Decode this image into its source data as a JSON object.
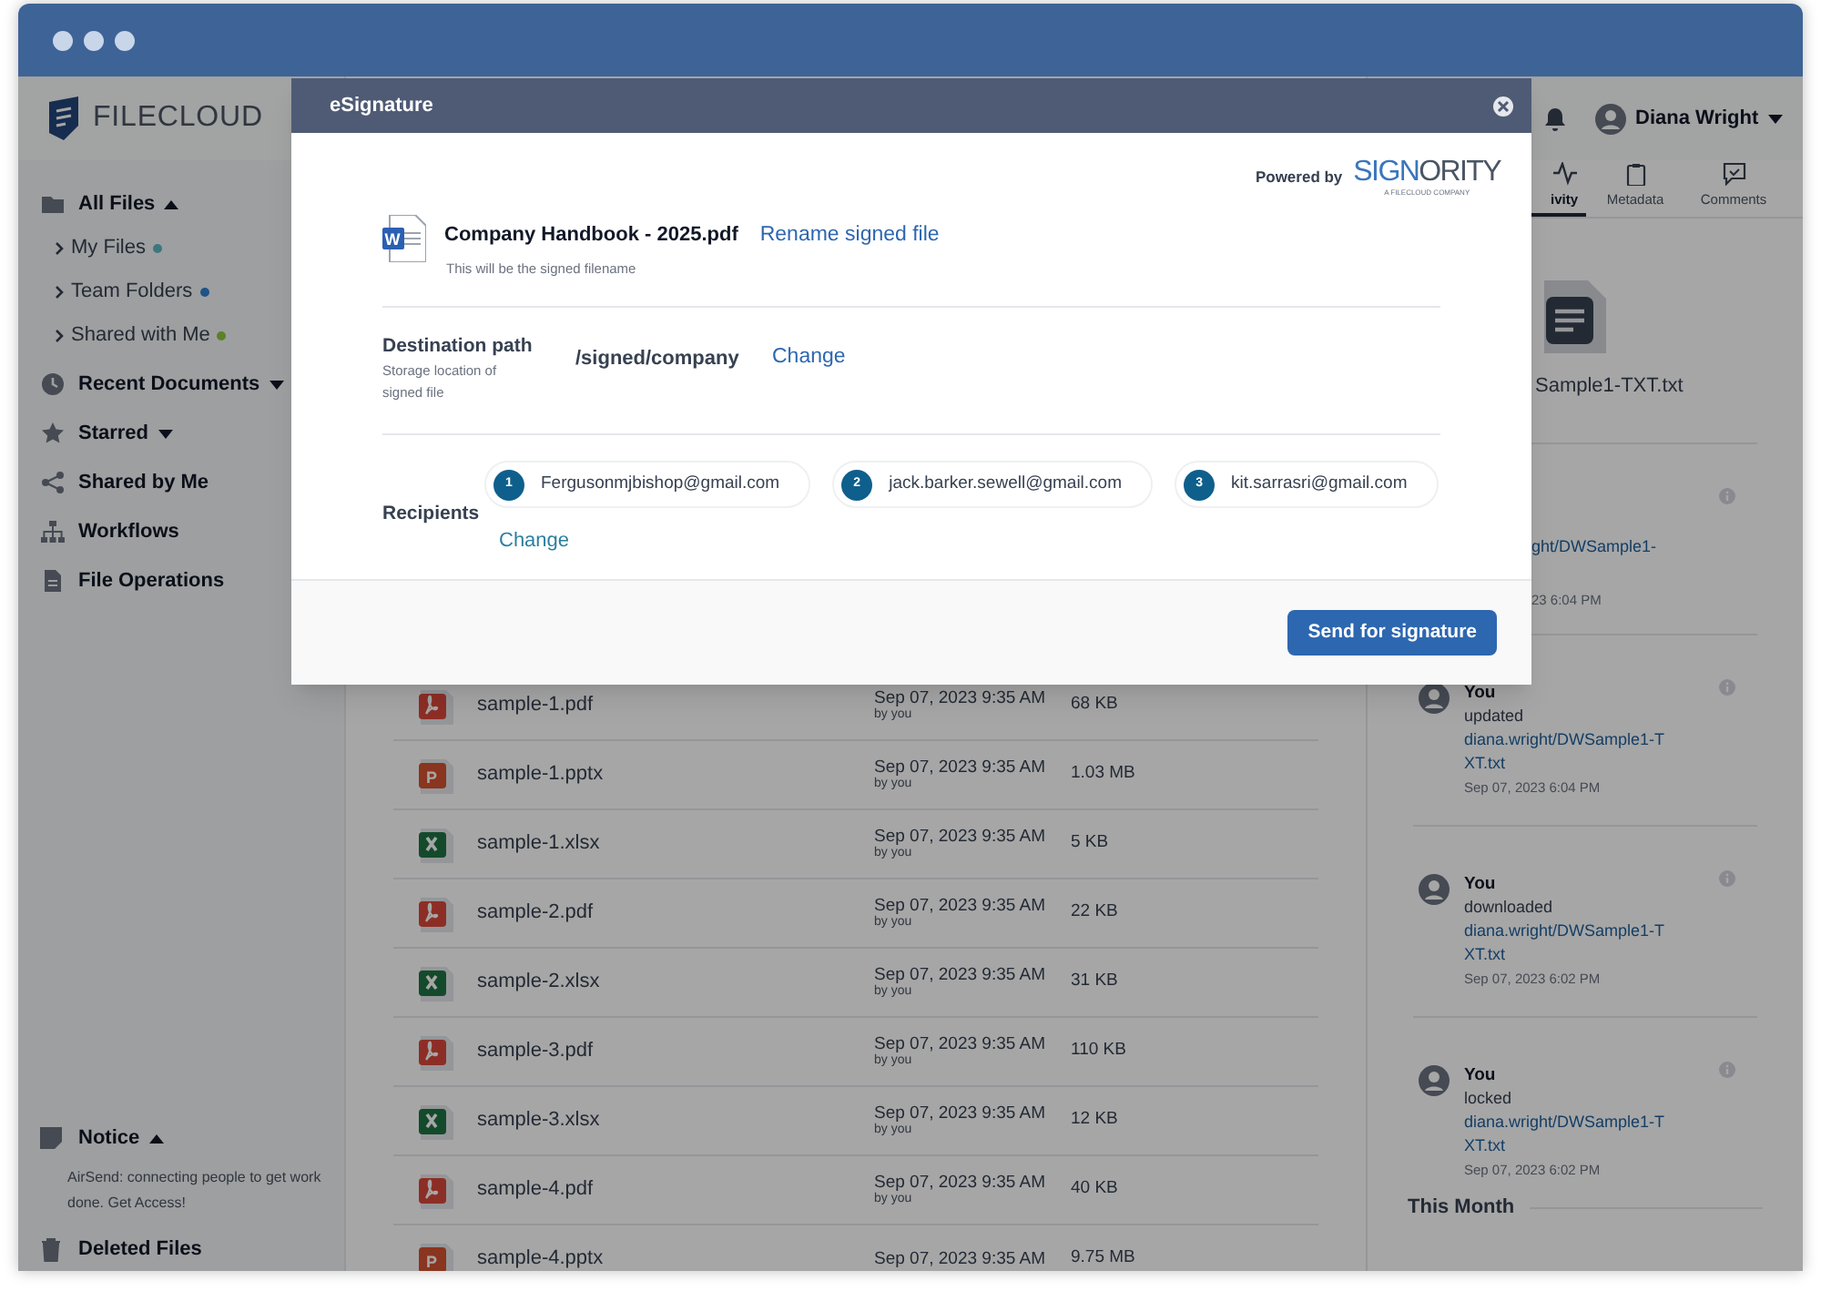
{
  "app": {
    "logo_text": "FILECLOUD"
  },
  "sidebar": {
    "items": [
      {
        "kind": "folder",
        "label": "All Files",
        "expanded": true,
        "children": [
          {
            "label": "My Files",
            "color": "#3e767e"
          },
          {
            "label": "Team Folders",
            "color": "#1f5387"
          },
          {
            "label": "Shared with Me",
            "color": "#5b8129"
          }
        ]
      },
      {
        "kind": "clock",
        "label": "Recent Documents",
        "expanded": false
      },
      {
        "kind": "star",
        "label": "Starred",
        "expanded": false
      },
      {
        "kind": "share",
        "label": "Shared by Me"
      },
      {
        "kind": "workflow",
        "label": "Workflows"
      },
      {
        "kind": "doc",
        "label": "File Operations"
      }
    ],
    "notice": {
      "title": "Notice",
      "expanded": true,
      "text": "AirSend: connecting people to get work done. Get Access!"
    },
    "footer_item": {
      "label": "Deleted Files"
    }
  },
  "files": [
    {
      "kind": "pdf",
      "name": "sample-1.pdf",
      "modified": "Sep 07, 2023 9:35 AM",
      "by": "by you",
      "size": "68 KB"
    },
    {
      "kind": "pptx",
      "icon_letter": "P",
      "name": "sample-1.pptx",
      "modified": "Sep 07, 2023 9:35 AM",
      "by": "by you",
      "size": "1.03 MB"
    },
    {
      "kind": "xlsx",
      "name": "sample-1.xlsx",
      "modified": "Sep 07, 2023 9:35 AM",
      "by": "by you",
      "size": "5 KB"
    },
    {
      "kind": "pdf",
      "name": "sample-2.pdf",
      "modified": "Sep 07, 2023 9:35 AM",
      "by": "by you",
      "size": "22 KB"
    },
    {
      "kind": "xlsx",
      "name": "sample-2.xlsx",
      "modified": "Sep 07, 2023 9:35 AM",
      "by": "by you",
      "size": "31 KB"
    },
    {
      "kind": "pdf",
      "name": "sample-3.pdf",
      "modified": "Sep 07, 2023 9:35 AM",
      "by": "by you",
      "size": "110 KB"
    },
    {
      "kind": "xlsx",
      "name": "sample-3.xlsx",
      "modified": "Sep 07, 2023 9:35 AM",
      "by": "by you",
      "size": "12 KB"
    },
    {
      "kind": "pdf",
      "name": "sample-4.pdf",
      "modified": "Sep 07, 2023 9:35 AM",
      "by": "by you",
      "size": "40 KB"
    },
    {
      "kind": "pptx",
      "icon_letter": "P",
      "name": "sample-4.pptx",
      "modified": "Sep 07, 2023 9:35 AM",
      "size": "9.75 MB"
    }
  ],
  "user": {
    "name": "Diana Wright"
  },
  "right_panel": {
    "tabs": [
      {
        "label": "ivity",
        "selected": true
      },
      {
        "label": "Metadata",
        "selected": false
      },
      {
        "label": "Comments",
        "selected": false
      }
    ],
    "preview_name": "Sample1-TXT.txt",
    "activity": [
      {
        "kind": "partial",
        "path": "ght/DWSample1-",
        "date": "23 6:04 PM"
      },
      {
        "kind": "full",
        "user": "You",
        "action": "updated",
        "path": "diana.wright/DWSample1-TXT.txt",
        "date": "Sep 07, 2023 6:04 PM"
      },
      {
        "kind": "full",
        "user": "You",
        "action": "downloaded",
        "path": "diana.wright/DWSample1-TXT.txt",
        "date": "Sep 07, 2023 6:02 PM"
      },
      {
        "kind": "full",
        "user": "You",
        "action": "locked",
        "path": "diana.wright/DWSample1-TXT.txt",
        "date": "Sep 07, 2023 6:02 PM"
      }
    ],
    "section": "This Month"
  },
  "dialog": {
    "title": "eSignature",
    "powered_by": "Powered by",
    "brand_a": "SIGN",
    "brand_b": "ORITY",
    "brand_tag": "A FILECLOUD COMPANY",
    "file_icon_letter": "W",
    "file_name": "Company Handbook - 2025.pdf",
    "rename_link": "Rename signed file",
    "file_hint": "This will be the signed filename",
    "destination_label": "Destination path",
    "destination_hint": "Storage location of signed file",
    "destination": "/signed/company",
    "destination_change": "Change",
    "recipients_label": "Recipients",
    "recipients": [
      {
        "number": "1",
        "email": "Fergusonmjbishop@gmail.com"
      },
      {
        "number": "2",
        "email": "jack.barker.sewell@gmail.com"
      },
      {
        "number": "3",
        "email": "kit.sarrasri@gmail.com"
      }
    ],
    "recipients_change": "Change",
    "send_button": "Send for signature"
  }
}
